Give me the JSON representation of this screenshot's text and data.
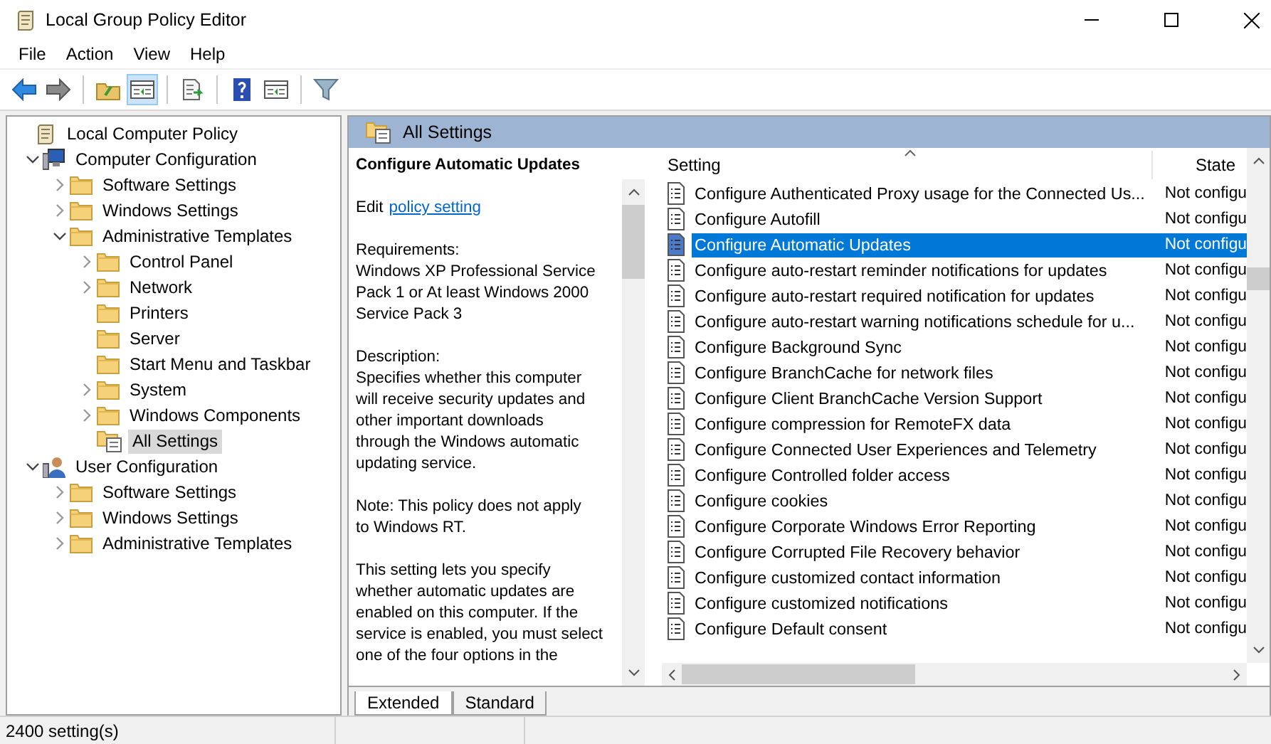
{
  "window": {
    "title": "Local Group Policy Editor"
  },
  "menu": [
    "File",
    "Action",
    "View",
    "Help"
  ],
  "toolbar": [
    {
      "kind": "back",
      "pressed": false
    },
    {
      "kind": "forward",
      "pressed": false
    },
    {
      "kind": "up",
      "pressed": false
    },
    {
      "kind": "tree",
      "pressed": true
    },
    {
      "kind": "export",
      "pressed": false
    },
    {
      "kind": "help",
      "pressed": false
    },
    {
      "kind": "pane",
      "pressed": false
    },
    {
      "kind": "filter",
      "pressed": false
    }
  ],
  "tree": [
    {
      "label": "Local Computer Policy",
      "kind": "policy",
      "selected": false,
      "children": [
        {
          "label": "Computer Configuration",
          "kind": "computer",
          "selected": false,
          "expanded": true,
          "children": [
            {
              "label": "Software Settings",
              "kind": "folder",
              "selected": false,
              "expanded": false
            },
            {
              "label": "Windows Settings",
              "kind": "folder",
              "selected": false,
              "expanded": false
            },
            {
              "label": "Administrative Templates",
              "kind": "folder",
              "selected": false,
              "expanded": true,
              "children": [
                {
                  "label": "Control Panel",
                  "kind": "folder",
                  "selected": false,
                  "expanded": false
                },
                {
                  "label": "Network",
                  "kind": "folder",
                  "selected": false,
                  "expanded": false
                },
                {
                  "label": "Printers",
                  "kind": "folder",
                  "selected": false
                },
                {
                  "label": "Server",
                  "kind": "folder",
                  "selected": false
                },
                {
                  "label": "Start Menu and Taskbar",
                  "kind": "folder",
                  "selected": false
                },
                {
                  "label": "System",
                  "kind": "folder",
                  "selected": false,
                  "expanded": false
                },
                {
                  "label": "Windows Components",
                  "kind": "folder",
                  "selected": false,
                  "expanded": false
                },
                {
                  "label": "All Settings",
                  "kind": "all-settings",
                  "selected": true
                }
              ]
            }
          ]
        },
        {
          "label": "User Configuration",
          "kind": "user",
          "selected": false,
          "expanded": true,
          "children": [
            {
              "label": "Software Settings",
              "kind": "folder",
              "selected": false,
              "expanded": false
            },
            {
              "label": "Windows Settings",
              "kind": "folder",
              "selected": false,
              "expanded": false
            },
            {
              "label": "Administrative Templates",
              "kind": "folder",
              "selected": false,
              "expanded": false
            }
          ]
        }
      ]
    }
  ],
  "pane_header": "All Settings",
  "description": {
    "title": "Configure Automatic Updates",
    "edit_prefix": "Edit",
    "edit_link": "policy setting",
    "paragraphs": [
      [
        "Requirements:",
        "Windows XP Professional Service",
        "Pack 1 or At least Windows 2000",
        "Service Pack 3"
      ],
      [
        "Description:",
        "Specifies whether this computer",
        "will receive security updates and",
        "other important downloads",
        "through the Windows automatic",
        "updating service."
      ],
      [
        "Note: This policy does not apply",
        "to Windows RT."
      ],
      [
        "This setting lets you specify",
        "whether automatic updates are",
        "enabled on this computer. If the",
        "service is enabled, you must select",
        "one of the four options in the"
      ]
    ]
  },
  "table": {
    "columns": [
      "Setting",
      "State"
    ],
    "rows": [
      {
        "setting": "Configure Authenticated Proxy usage for the Connected Us...",
        "state": "Not configu",
        "selected": false
      },
      {
        "setting": "Configure Autofill",
        "state": "Not configu",
        "selected": false
      },
      {
        "setting": "Configure Automatic Updates",
        "state": "Not configu",
        "selected": true
      },
      {
        "setting": "Configure auto-restart reminder notifications for updates",
        "state": "Not configu",
        "selected": false
      },
      {
        "setting": "Configure auto-restart required notification for updates",
        "state": "Not configu",
        "selected": false
      },
      {
        "setting": "Configure auto-restart warning notifications schedule for u...",
        "state": "Not configu",
        "selected": false
      },
      {
        "setting": "Configure Background Sync",
        "state": "Not configu",
        "selected": false
      },
      {
        "setting": "Configure BranchCache for network files",
        "state": "Not configu",
        "selected": false
      },
      {
        "setting": "Configure Client BranchCache Version Support",
        "state": "Not configu",
        "selected": false
      },
      {
        "setting": "Configure compression for RemoteFX data",
        "state": "Not configu",
        "selected": false
      },
      {
        "setting": "Configure Connected User Experiences and Telemetry",
        "state": "Not configu",
        "selected": false
      },
      {
        "setting": "Configure Controlled folder access",
        "state": "Not configu",
        "selected": false
      },
      {
        "setting": "Configure cookies",
        "state": "Not configu",
        "selected": false
      },
      {
        "setting": "Configure Corporate Windows Error Reporting",
        "state": "Not configu",
        "selected": false
      },
      {
        "setting": "Configure Corrupted File Recovery behavior",
        "state": "Not configu",
        "selected": false
      },
      {
        "setting": "Configure customized contact information",
        "state": "Not configu",
        "selected": false
      },
      {
        "setting": "Configure customized notifications",
        "state": "Not configu",
        "selected": false
      },
      {
        "setting": "Configure Default consent",
        "state": "Not configu",
        "selected": false
      }
    ]
  },
  "tabs": [
    {
      "label": "Extended",
      "selected": true
    },
    {
      "label": "Standard",
      "selected": false
    }
  ],
  "status_bar": "2400 setting(s)"
}
